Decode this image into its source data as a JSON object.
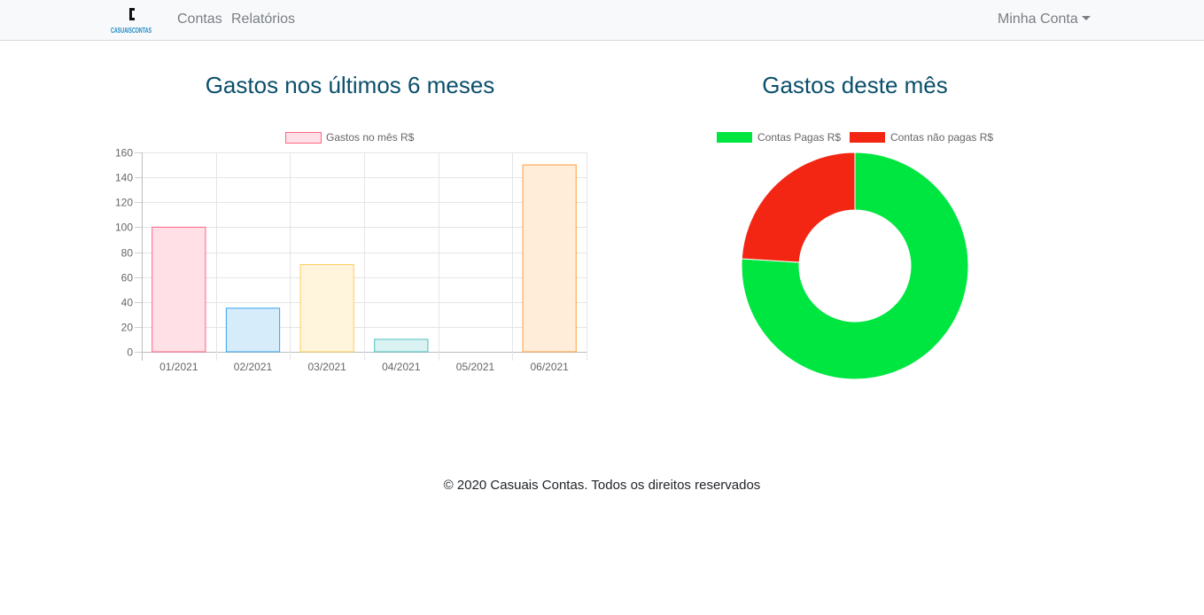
{
  "navbar": {
    "brand_logo_text": "CASUAISCONTAS",
    "links": [
      "Contas",
      "Relatórios"
    ],
    "account_label": "Minha Conta"
  },
  "left_chart": {
    "title": "Gastos nos últimos 6 meses"
  },
  "right_chart": {
    "title": "Gastos deste mês"
  },
  "chart_data": [
    {
      "type": "bar",
      "legend": [
        "Gastos no mês R$"
      ],
      "categories": [
        "01/2021",
        "02/2021",
        "03/2021",
        "04/2021",
        "05/2021",
        "06/2021"
      ],
      "values": [
        100,
        35,
        70,
        10,
        0,
        150
      ],
      "ylim": [
        0,
        160
      ],
      "yticks": [
        "0",
        "20",
        "40",
        "60",
        "80",
        "100",
        "120",
        "140",
        "160"
      ],
      "grid": true,
      "legend_position": "top",
      "bar_colors": [
        {
          "fill": "#ffe0e6",
          "stroke": "#ff6384"
        },
        {
          "fill": "#d7ecfb",
          "stroke": "#36a2eb"
        },
        {
          "fill": "#fff5dd",
          "stroke": "#ffcd56"
        },
        {
          "fill": "#dbf2f2",
          "stroke": "#4bc0c0"
        },
        {
          "fill": "#ebe0ff",
          "stroke": "#9966ff"
        },
        {
          "fill": "#ffecd9",
          "stroke": "#ff9f40"
        }
      ]
    },
    {
      "type": "pie",
      "variant": "doughnut",
      "labels": [
        "Contas Pagas R$",
        "Contas não pagas R$"
      ],
      "values": [
        76,
        24
      ],
      "colors": [
        "#00e640",
        "#f22613"
      ],
      "legend_position": "top"
    }
  ],
  "footer": {
    "text": "© 2020 Casuais Contas. Todos os direitos reservados"
  }
}
